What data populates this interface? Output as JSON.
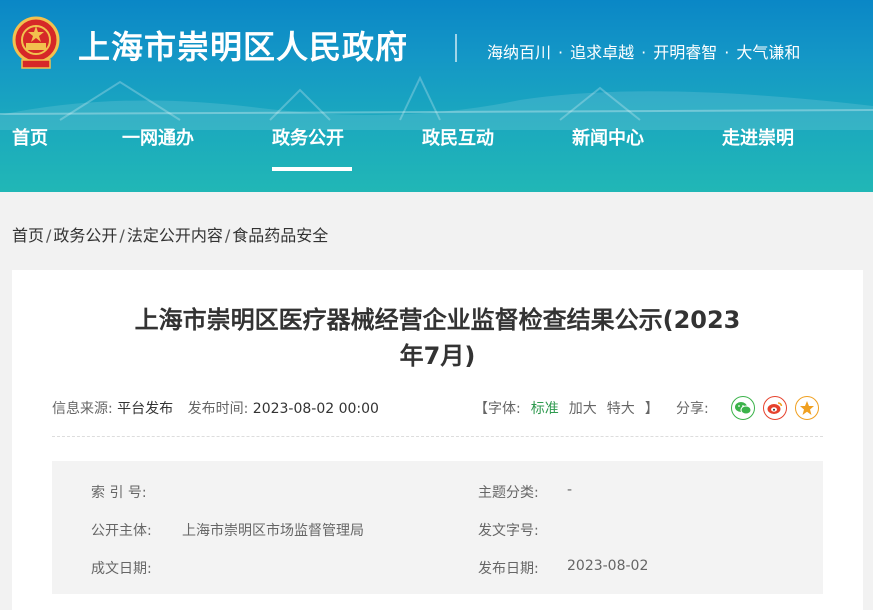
{
  "header": {
    "site_title": "上海市崇明区人民政府",
    "slogan": [
      "海纳百川",
      "追求卓越",
      "开明睿智",
      "大气谦和"
    ],
    "slogan_separator": "·"
  },
  "nav": {
    "items": [
      "首页",
      "一网通办",
      "政务公开",
      "政民互动",
      "新闻中心",
      "走进崇明"
    ],
    "active_index": 2
  },
  "breadcrumb": {
    "items": [
      "首页",
      "政务公开",
      "法定公开内容",
      "食品药品安全"
    ],
    "separator": "/"
  },
  "article": {
    "title_line1": "上海市崇明区医疗器械经营企业监督检查结果公示(2023",
    "title_line2": "年7月)",
    "source_label": "信息来源:",
    "source_value": "平台发布",
    "date_label": "发布时间:",
    "date_value": "2023-08-02 00:00",
    "font_open": "【字体:",
    "font_standard": "标准",
    "font_large": "加大",
    "font_xlarge": "特大",
    "font_close": "】",
    "share_label": "分享:"
  },
  "info": {
    "index_label": "索 引 号:",
    "index_value": "",
    "category_label": "主题分类:",
    "category_value": "-",
    "publisher_label": "公开主体:",
    "publisher_value": "上海市崇明区市场监督管理局",
    "doc_no_label": "发文字号:",
    "doc_no_value": "",
    "written_date_label": "成文日期:",
    "written_date_value": "",
    "publish_date_label": "发布日期:",
    "publish_date_value": "2023-08-02"
  },
  "colors": {
    "header_top": "#0a87c6",
    "header_bottom": "#21b7b6",
    "active_font": "#2f9a4f",
    "wechat": "#3bb34a",
    "weibo": "#e6422d",
    "favorite": "#f0a020"
  },
  "icons": {
    "emblem": "national-emblem-icon",
    "wechat": "wechat-icon",
    "weibo": "weibo-icon",
    "favorite": "star-icon"
  }
}
